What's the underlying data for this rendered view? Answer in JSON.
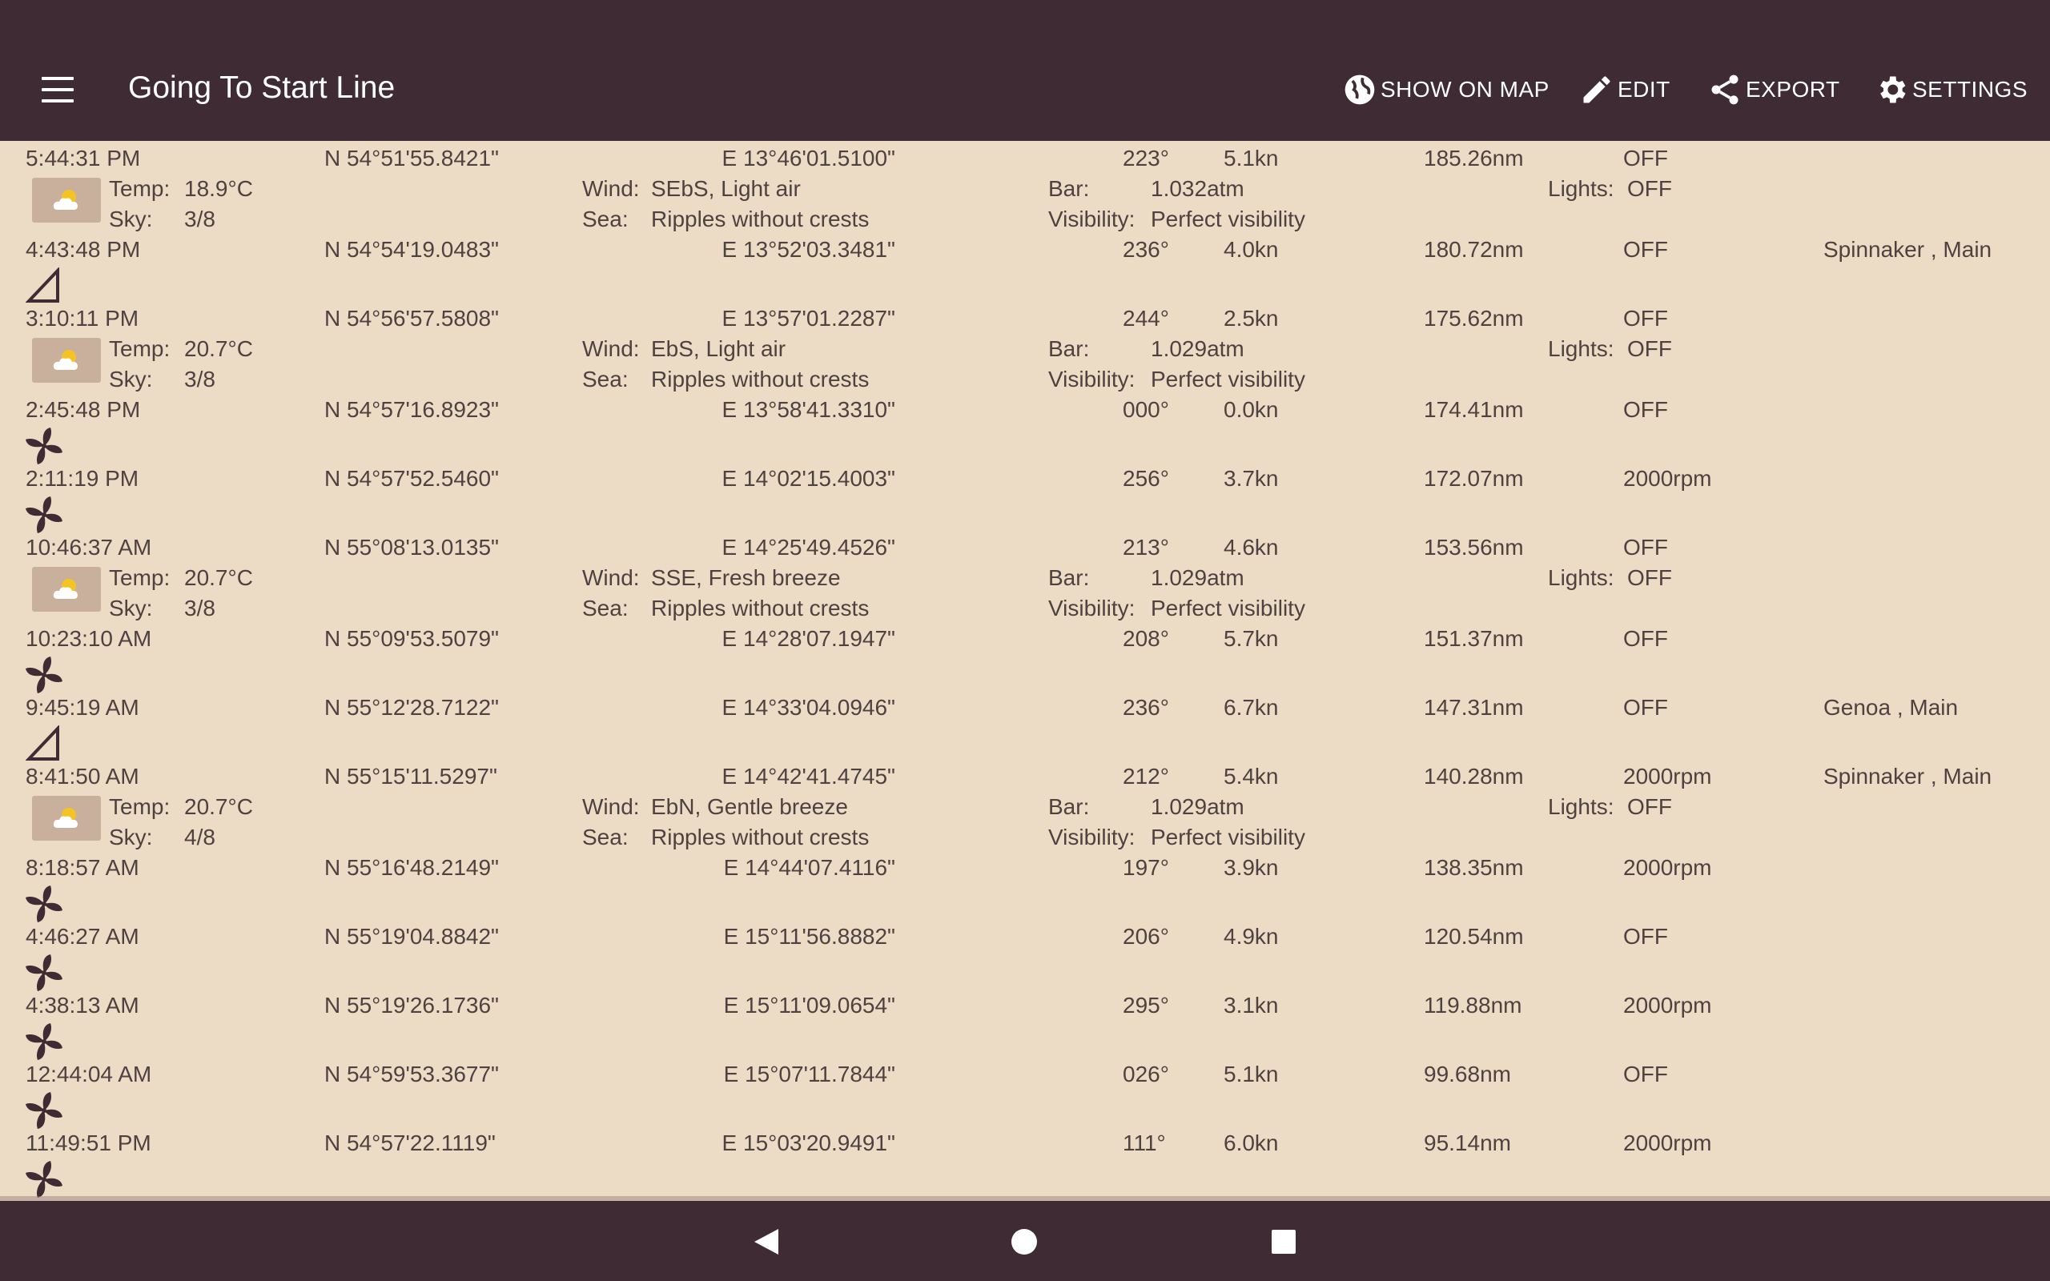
{
  "appbar": {
    "title": "Going To Start Line",
    "actions": [
      {
        "label": "SHOW ON MAP",
        "icon": "globe-icon"
      },
      {
        "label": "EDIT",
        "icon": "pencil-icon"
      },
      {
        "label": "EXPORT",
        "icon": "share-icon"
      },
      {
        "label": "SETTINGS",
        "icon": "gear-icon"
      }
    ]
  },
  "labels": {
    "temp": "Temp:",
    "sky": "Sky:",
    "wind": "Wind:",
    "sea": "Sea:",
    "bar": "Bar:",
    "visibility": "Visibility:",
    "lights": "Lights:"
  },
  "entries": [
    {
      "time": "5:44:31 PM",
      "lat": "N 54°51'55.8421\"",
      "lon": "E 13°46'01.5100\"",
      "heading": "223°",
      "speed": "5.1kn",
      "distance": "185.26nm",
      "engine": "OFF",
      "sails": "",
      "icon": "weather-icon",
      "weather": {
        "temp": "18.9°C",
        "sky": "3/8",
        "wind": "SEbS, Light air",
        "sea": "Ripples without crests",
        "bar": "1.032atm",
        "visibility": "Perfect visibility",
        "lights": "OFF"
      }
    },
    {
      "time": "4:43:48 PM",
      "lat": "N 54°54'19.0483\"",
      "lon": "E 13°52'03.3481\"",
      "heading": "236°",
      "speed": "4.0kn",
      "distance": "180.72nm",
      "engine": "OFF",
      "sails": "Spinnaker , Main",
      "icon": "sail-icon"
    },
    {
      "time": "3:10:11 PM",
      "lat": "N 54°56'57.5808\"",
      "lon": "E 13°57'01.2287\"",
      "heading": "244°",
      "speed": "2.5kn",
      "distance": "175.62nm",
      "engine": "OFF",
      "sails": "",
      "icon": "weather-icon",
      "weather": {
        "temp": "20.7°C",
        "sky": "3/8",
        "wind": "EbS, Light air",
        "sea": "Ripples without crests",
        "bar": "1.029atm",
        "visibility": "Perfect visibility",
        "lights": "OFF"
      }
    },
    {
      "time": "2:45:48 PM",
      "lat": "N 54°57'16.8923\"",
      "lon": "E 13°58'41.3310\"",
      "heading": "000°",
      "speed": "0.0kn",
      "distance": "174.41nm",
      "engine": "OFF",
      "sails": "",
      "icon": "engine-icon"
    },
    {
      "time": "2:11:19 PM",
      "lat": "N 54°57'52.5460\"",
      "lon": "E 14°02'15.4003\"",
      "heading": "256°",
      "speed": "3.7kn",
      "distance": "172.07nm",
      "engine": "2000rpm",
      "sails": "",
      "icon": "engine-icon"
    },
    {
      "time": "10:46:37 AM",
      "lat": "N 55°08'13.0135\"",
      "lon": "E 14°25'49.4526\"",
      "heading": "213°",
      "speed": "4.6kn",
      "distance": "153.56nm",
      "engine": "OFF",
      "sails": "",
      "icon": "weather-icon",
      "weather": {
        "temp": "20.7°C",
        "sky": "3/8",
        "wind": "SSE, Fresh breeze",
        "sea": "Ripples without crests",
        "bar": "1.029atm",
        "visibility": "Perfect visibility",
        "lights": "OFF"
      }
    },
    {
      "time": "10:23:10 AM",
      "lat": "N 55°09'53.5079\"",
      "lon": "E 14°28'07.1947\"",
      "heading": "208°",
      "speed": "5.7kn",
      "distance": "151.37nm",
      "engine": "OFF",
      "sails": "",
      "icon": "engine-icon"
    },
    {
      "time": "9:45:19 AM",
      "lat": "N 55°12'28.7122\"",
      "lon": "E 14°33'04.0946\"",
      "heading": "236°",
      "speed": "6.7kn",
      "distance": "147.31nm",
      "engine": "OFF",
      "sails": "Genoa , Main",
      "icon": "sail-icon"
    },
    {
      "time": "8:41:50 AM",
      "lat": "N 55°15'11.5297\"",
      "lon": "E 14°42'41.4745\"",
      "heading": "212°",
      "speed": "5.4kn",
      "distance": "140.28nm",
      "engine": "2000rpm",
      "sails": "Spinnaker , Main",
      "icon": "weather-icon",
      "weather": {
        "temp": "20.7°C",
        "sky": "4/8",
        "wind": "EbN, Gentle breeze",
        "sea": "Ripples without crests",
        "bar": "1.029atm",
        "visibility": "Perfect visibility",
        "lights": "OFF"
      }
    },
    {
      "time": "8:18:57 AM",
      "lat": "N 55°16'48.2149\"",
      "lon": "E 14°44'07.4116\"",
      "heading": "197°",
      "speed": "3.9kn",
      "distance": "138.35nm",
      "engine": "2000rpm",
      "sails": "",
      "icon": "engine-icon"
    },
    {
      "time": "4:46:27 AM",
      "lat": "N 55°19'04.8842\"",
      "lon": "E 15°11'56.8882\"",
      "heading": "206°",
      "speed": "4.9kn",
      "distance": "120.54nm",
      "engine": "OFF",
      "sails": "",
      "icon": "engine-icon"
    },
    {
      "time": "4:38:13 AM",
      "lat": "N 55°19'26.1736\"",
      "lon": "E 15°11'09.0654\"",
      "heading": "295°",
      "speed": "3.1kn",
      "distance": "119.88nm",
      "engine": "2000rpm",
      "sails": "",
      "icon": "engine-icon"
    },
    {
      "time": "12:44:04 AM",
      "lat": "N 54°59'53.3677\"",
      "lon": "E 15°07'11.7844\"",
      "heading": "026°",
      "speed": "5.1kn",
      "distance": "99.68nm",
      "engine": "OFF",
      "sails": "",
      "icon": "engine-icon"
    },
    {
      "time": "11:49:51 PM",
      "lat": "N 54°57'22.1119\"",
      "lon": "E 15°03'20.9491\"",
      "heading": "111°",
      "speed": "6.0kn",
      "distance": "95.14nm",
      "engine": "2000rpm",
      "sails": "",
      "icon": "engine-icon"
    }
  ],
  "navbar": {
    "buttons": [
      "back-icon",
      "home-icon",
      "recents-icon"
    ]
  }
}
